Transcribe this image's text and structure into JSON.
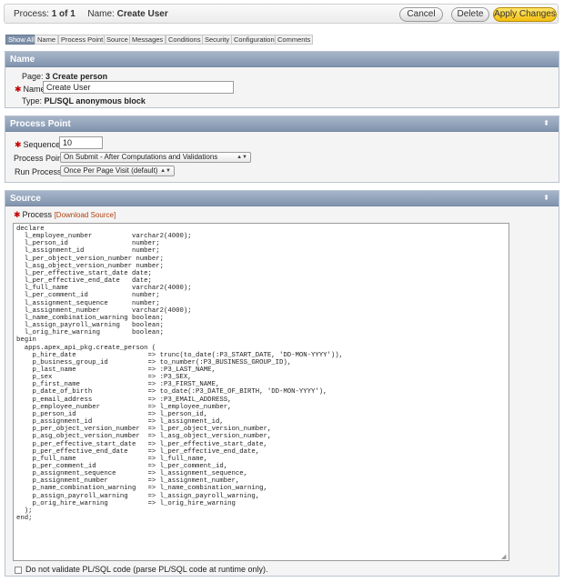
{
  "topbar": {
    "process_label": "Process:",
    "process_position": "1 of 1",
    "name_label": "Name:",
    "name_value": "Create User",
    "cancel_label": "Cancel",
    "delete_label": "Delete",
    "apply_label": "Apply Changes"
  },
  "tabs": [
    "Show All",
    "Name",
    "Process Point",
    "Source",
    "Messages",
    "Conditions",
    "Security",
    "Configuration",
    "Comments"
  ],
  "name_region": {
    "title": "Name",
    "page_label": "Page:",
    "page_value": "3 Create person",
    "name_label": "Name",
    "name_value": "Create User",
    "type_label": "Type:",
    "type_value": "PL/SQL anonymous block"
  },
  "process_point_region": {
    "title": "Process Point",
    "sequence_label": "Sequence",
    "sequence_value": "10",
    "process_point_label": "Process Point",
    "process_point_value": "On Submit - After Computations and Validations",
    "run_process_label": "Run Process",
    "run_process_value": "Once Per Page Visit (default)"
  },
  "source_region": {
    "title": "Source",
    "process_label": "Process",
    "download_link": "[Download Source]",
    "code": "declare\n  l_employee_number          varchar2(4000);\n  l_person_id                number;\n  l_assignment_id            number;\n  l_per_object_version_number number;\n  l_asg_object_version_number number;\n  l_per_effective_start_date date;\n  l_per_effective_end_date   date;\n  l_full_name                varchar2(4000);\n  l_per_comment_id           number;\n  l_assignment_sequence      number;\n  l_assignment_number        varchar2(4000);\n  l_name_combination_warning boolean;\n  l_assign_payroll_warning   boolean;\n  l_orig_hire_warning        boolean;\nbegin\n  apps.apex_api_pkg.create_person (\n    p_hire_date                  => trunc(to_date(:P3_START_DATE, 'DD-MON-YYYY')),\n    p_business_group_id          => to_number(:P3_BUSINESS_GROUP_ID),\n    p_last_name                  => :P3_LAST_NAME,\n    p_sex                        => :P3_SEX,\n    p_first_name                 => :P3_FIRST_NAME,\n    p_date_of_birth              => to_date(:P3_DATE_OF_BIRTH, 'DD-MON-YYYY'),\n    p_email_address              => :P3_EMAIL_ADDRESS,\n    p_employee_number            => l_employee_number,\n    p_person_id                  => l_person_id,\n    p_assignment_id              => l_assignment_id,\n    p_per_object_version_number  => l_per_object_version_number,\n    p_asg_object_version_number  => l_asg_object_version_number,\n    p_per_effective_start_date   => l_per_effective_start_date,\n    p_per_effective_end_date     => l_per_effective_end_date,\n    p_full_name                  => l_full_name,\n    p_per_comment_id             => l_per_comment_id,\n    p_assignment_sequence        => l_assignment_sequence,\n    p_assignment_number          => l_assignment_number,\n    p_name_combination_warning   => l_name_combination_warning,\n    p_assign_payroll_warning     => l_assign_payroll_warning,\n    p_orig_hire_warning          => l_orig_hire_warning\n  );\nend;",
    "checkbox_label": "Do not validate PL/SQL code (parse PL/SQL code at runtime only)."
  },
  "icons": {
    "required": "required-asterisk-icon",
    "collapse": "collapse-arrow-icon",
    "dropdown": "chevron-down-icon",
    "resize": "resize-grip-icon"
  }
}
